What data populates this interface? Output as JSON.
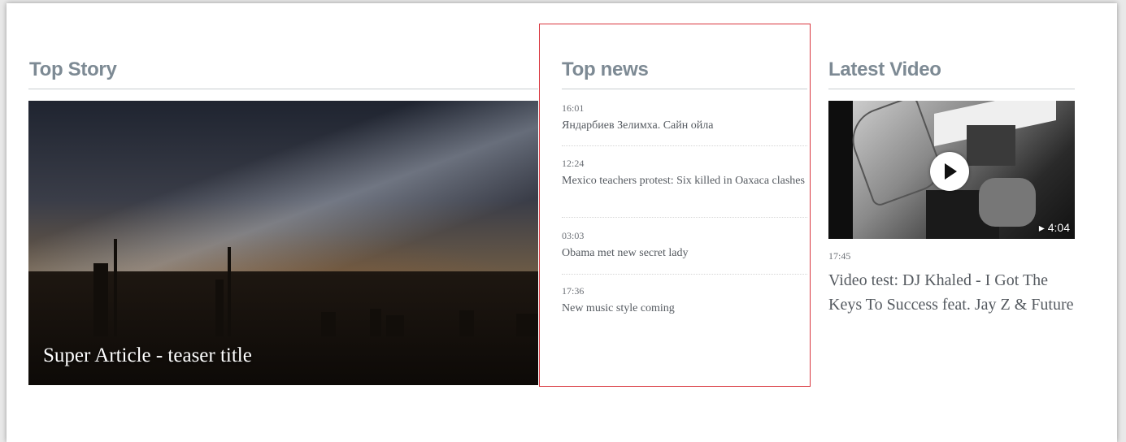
{
  "top_story": {
    "heading": "Top Story",
    "teaser_title": "Super Article - teaser title"
  },
  "top_news": {
    "heading": "Top news",
    "items": [
      {
        "time": "16:01",
        "text": "Яндарбиев Зелимха. Сайн ойла"
      },
      {
        "time": "12:24",
        "text": "Mexico teachers protest: Six killed in Oaxaca clashes"
      },
      {
        "time": "03:03",
        "text": "Obama met new secret lady"
      },
      {
        "time": "17:36",
        "text": "New music style coming"
      }
    ],
    "highlight_color": "#d9363e"
  },
  "latest_video": {
    "heading": "Latest Video",
    "duration": "▸ 4:04",
    "time": "17:45",
    "title": "Video test: DJ Khaled - I Got The Keys To Success feat. Jay Z & Future",
    "play_icon": "play-icon"
  }
}
